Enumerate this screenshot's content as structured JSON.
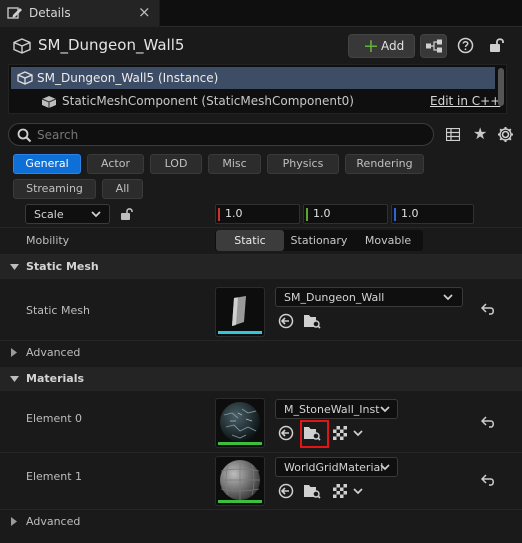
{
  "tab": {
    "title": "Details",
    "close": "×"
  },
  "header": {
    "object_name": "SM_Dungeon_Wall5",
    "add_label": "Add",
    "add_plus": "+"
  },
  "tree": {
    "root_label": "SM_Dungeon_Wall5 (Instance)",
    "child_label": "StaticMeshComponent (StaticMeshComponent0)",
    "edit_link": "Edit in C++"
  },
  "search": {
    "placeholder": "Search"
  },
  "filters": [
    "General",
    "Actor",
    "LOD",
    "Misc",
    "Physics",
    "Rendering",
    "Streaming",
    "All"
  ],
  "active_filter": "General",
  "transform": {
    "scale_label": "Scale",
    "x": "1.0",
    "y": "1.0",
    "z": "1.0",
    "axis_colors": {
      "x": "#c8352c",
      "y": "#5da42c",
      "z": "#2a64d6"
    }
  },
  "mobility": {
    "label": "Mobility",
    "options": [
      "Static",
      "Stationary",
      "Movable"
    ],
    "selected": "Static"
  },
  "sections": {
    "static_mesh": "Static Mesh",
    "materials": "Materials",
    "advanced": "Advanced"
  },
  "static_mesh": {
    "label": "Static Mesh",
    "asset": "SM_Dungeon_Wall",
    "thumb_bar_color": "#2fc8d8"
  },
  "materials": [
    {
      "label": "Element 0",
      "asset": "M_StoneWall_Inst",
      "thumb_bar_color": "#3cbf3c"
    },
    {
      "label": "Element 1",
      "asset": "WorldGridMaterial",
      "thumb_bar_color": "#3cbf3c"
    }
  ],
  "colors": {
    "accent": "#0e6fd6",
    "selection": "#3e4d66",
    "highlight_box": "#e11515"
  }
}
